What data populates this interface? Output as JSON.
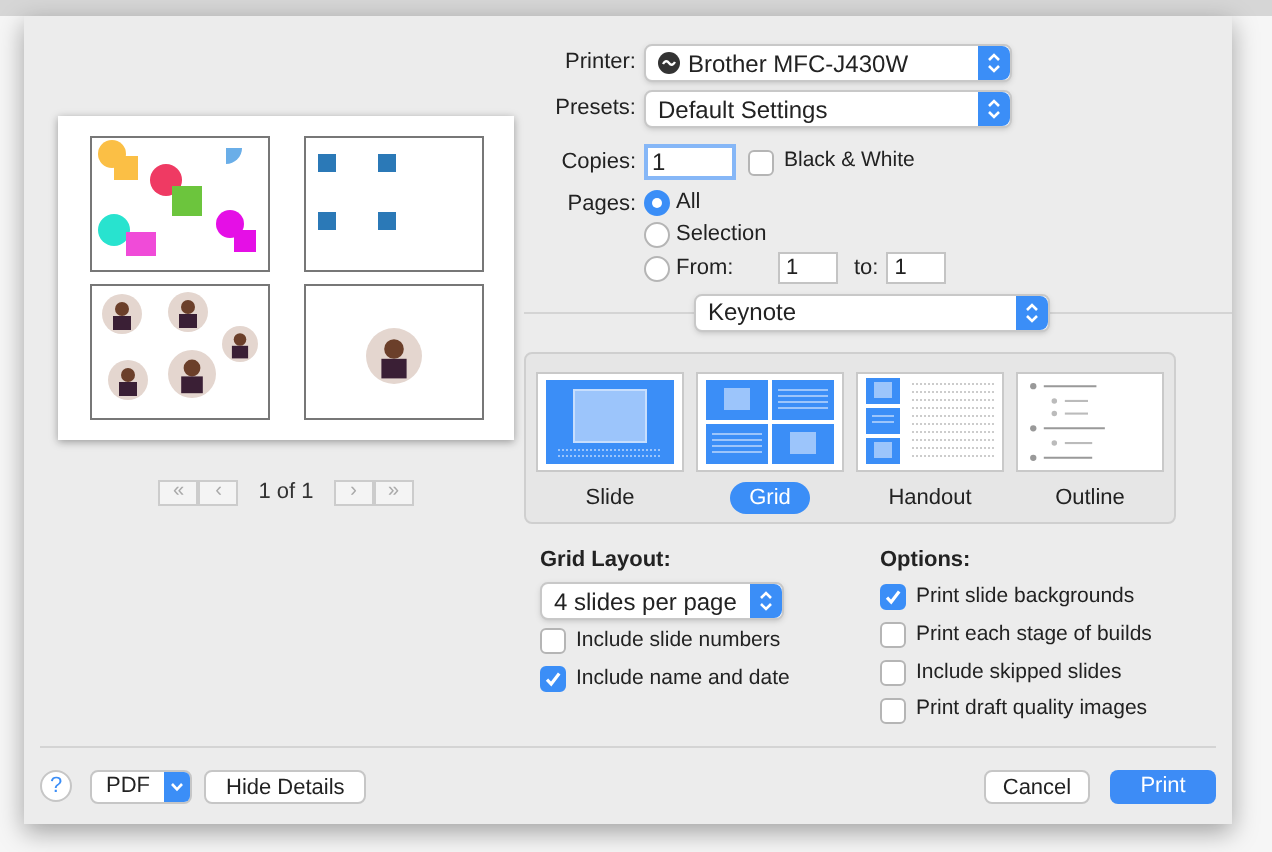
{
  "preview": {
    "pager": {
      "first": "«",
      "prev": "‹",
      "label": "1 of 1",
      "next": "›",
      "last": "»"
    }
  },
  "printer": {
    "label": "Printer:",
    "value": "Brother MFC-J430W"
  },
  "presets": {
    "label": "Presets:",
    "value": "Default Settings"
  },
  "copies": {
    "label": "Copies:",
    "value": "1",
    "black_white": {
      "label": "Black & White",
      "checked": false
    }
  },
  "pages": {
    "label": "Pages:",
    "options": [
      {
        "label": "All",
        "selected": true
      },
      {
        "label": "Selection",
        "selected": false
      },
      {
        "label": "From:",
        "selected": false
      }
    ],
    "from": "1",
    "to_label": "to:",
    "to": "1"
  },
  "app_menu": "Keynote",
  "layouts": [
    {
      "kind": "slide",
      "label": "Slide",
      "selected": false
    },
    {
      "kind": "grid",
      "label": "Grid",
      "selected": true
    },
    {
      "kind": "handout",
      "label": "Handout",
      "selected": false
    },
    {
      "kind": "outline",
      "label": "Outline",
      "selected": false
    }
  ],
  "grid_layout": {
    "title": "Grid Layout:",
    "value": "4 slides per page",
    "checks": [
      {
        "label": "Include slide numbers",
        "checked": false
      },
      {
        "label": "Include name and date",
        "checked": true
      }
    ]
  },
  "options": {
    "title": "Options:",
    "checks": [
      {
        "label": "Print slide backgrounds",
        "checked": true
      },
      {
        "label": "Print each stage of builds",
        "checked": false
      },
      {
        "label": "Include skipped slides",
        "checked": false
      },
      {
        "label": "Print draft quality images",
        "checked": false
      }
    ]
  },
  "footer": {
    "help": "?",
    "pdf": "PDF",
    "hide_details": "Hide Details",
    "cancel": "Cancel",
    "print": "Print"
  }
}
